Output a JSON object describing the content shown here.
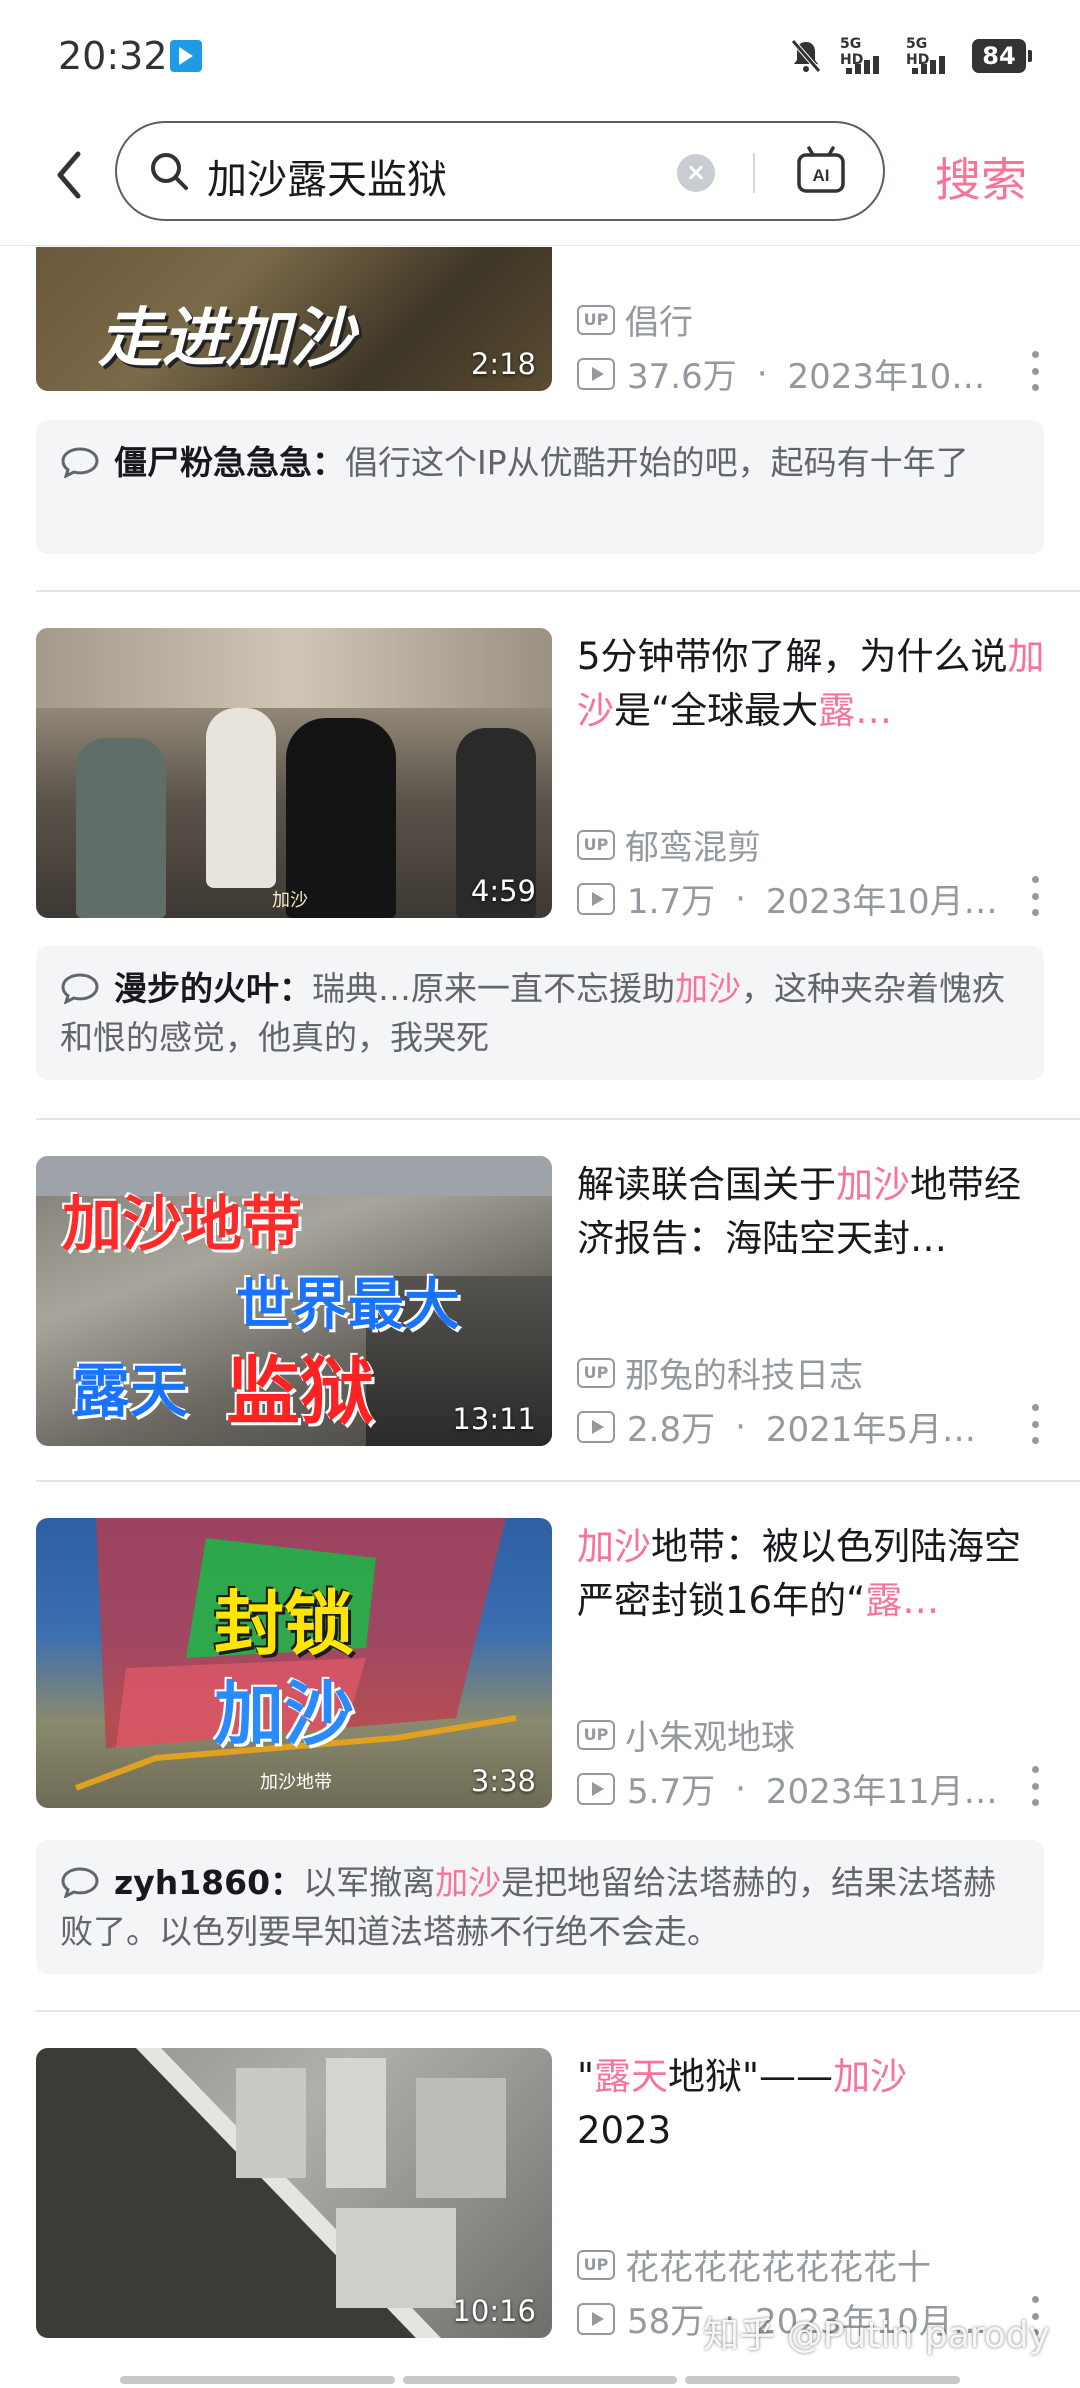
{
  "status_bar": {
    "time": "20:32",
    "net1": "5G HD",
    "net2": "5G HD",
    "battery": "84"
  },
  "search": {
    "query": "加沙露天监狱",
    "button": "搜索"
  },
  "results": [
    {
      "duration": "2:18",
      "thumb_text": "走进加沙",
      "uploader": "倡行",
      "views": "37.6万",
      "date": "2023年10…"
    },
    {
      "title_parts": [
        "5分钟带你了解，为什么说",
        "加沙",
        "是“全球最大",
        "露…"
      ],
      "duration": "4:59",
      "thumb_caption": "加沙",
      "uploader": "郁鸾混剪",
      "views": "1.7万",
      "date": "2023年10月…"
    },
    {
      "title_parts": [
        "解读联合国关于",
        "加沙",
        "地带经济报告：海陆空天封…"
      ],
      "duration": "13:11",
      "thumb_lines": [
        "加沙地带",
        "世界最大",
        "露天",
        "监狱"
      ],
      "uploader": "那兔的科技日志",
      "views": "2.8万",
      "date": "2021年5月…"
    },
    {
      "title_parts": [
        "加沙",
        "地带：被以色列陆海空严密封锁16年的“",
        "露…"
      ],
      "duration": "3:38",
      "thumb_lines": [
        "封锁",
        "加沙"
      ],
      "thumb_caption": "加沙地带",
      "uploader": "小朱观地球",
      "views": "5.7万",
      "date": "2023年11月…"
    },
    {
      "title_parts": [
        "\"",
        "露天",
        "地狱\"——",
        "加沙",
        "2023"
      ],
      "duration": "10:16",
      "uploader": "花花花花花花花花十",
      "views": "58万",
      "date": "2023年10月…"
    }
  ],
  "comments": [
    {
      "user": "僵尸粉急急急：",
      "text": "倡行这个IP从优酷开始的吧，起码有十年了"
    },
    {
      "user": "漫步的火叶：",
      "text_parts": [
        "瑞典…原来一直不忘援助",
        "加沙",
        "，这种夹杂着愧疚和恨的感觉，他真的，我哭死"
      ]
    },
    {
      "user": "zyh1860：",
      "text_parts": [
        "以军撤离",
        "加沙",
        "是把地留给法塔赫的，结果法塔赫败了。以色列要早知道法塔赫不行绝不会走。"
      ]
    }
  ],
  "watermark": "知乎 @Putin parody",
  "colors": {
    "accent": "#fb7299",
    "meta": "#9499a0"
  }
}
